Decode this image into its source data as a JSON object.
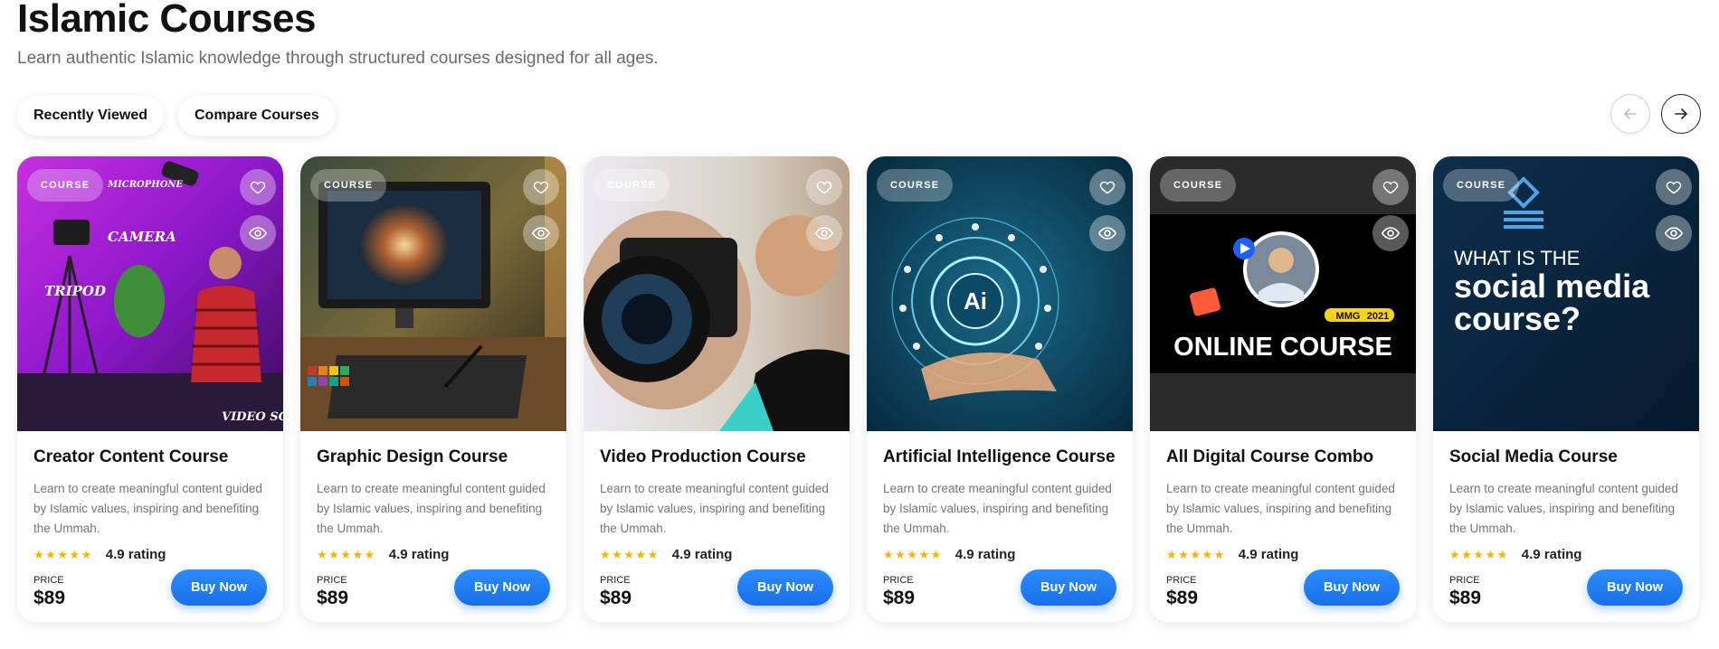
{
  "header": {
    "title": "Islamic Courses",
    "subtitle": "Learn authentic Islamic knowledge through structured courses designed for all ages."
  },
  "filters": {
    "recently_viewed": "Recently Viewed",
    "compare_courses": "Compare Courses"
  },
  "navigation": {
    "prev_icon": "arrow-left-icon",
    "next_icon": "arrow-right-icon"
  },
  "colors": {
    "accent": "#1a7bff",
    "star": "#f5b400"
  },
  "cards": [
    {
      "badge": "COURSE",
      "title": "Creator Content Course",
      "description": "Learn to create meaningful content guided by Islamic values, inspiring and benefiting the Ummah.",
      "stars": "★★★★★",
      "rating": "4.9 rating",
      "price_label": "PRICE",
      "price": "$89",
      "cta": "Buy Now",
      "image": {
        "words": [
          "MICROPHONE",
          "CAMERA",
          "TRIPOD",
          "VIDEO SCRIPT"
        ]
      }
    },
    {
      "badge": "COURSE",
      "title": "Graphic Design Course",
      "description": "Learn to create meaningful content guided by Islamic values, inspiring and benefiting the Ummah.",
      "stars": "★★★★★",
      "rating": "4.9 rating",
      "price_label": "PRICE",
      "price": "$89",
      "cta": "Buy Now"
    },
    {
      "badge": "COURSE",
      "title": "Video Production Course",
      "description": "Learn to create meaningful content guided by Islamic values, inspiring and benefiting the Ummah.",
      "stars": "★★★★★",
      "rating": "4.9 rating",
      "price_label": "PRICE",
      "price": "$89",
      "cta": "Buy Now"
    },
    {
      "badge": "COURSE",
      "title": "Artificial Intelligence Course",
      "description": "Learn to create meaningful content guided by Islamic values, inspiring and benefiting the Ummah.",
      "stars": "★★★★★",
      "rating": "4.9 rating",
      "price_label": "PRICE",
      "price": "$89",
      "cta": "Buy Now",
      "image": {
        "center_text": "Ai"
      }
    },
    {
      "badge": "COURSE",
      "title": "All Digital Course Combo",
      "description": "Learn to create meaningful content guided by Islamic values, inspiring and benefiting the Ummah.",
      "stars": "★★★★★",
      "rating": "4.9 rating",
      "price_label": "PRICE",
      "price": "$89",
      "cta": "Buy Now",
      "image": {
        "brand": "MMG",
        "year": "2021",
        "headline": "ONLINE COURSE"
      }
    },
    {
      "badge": "COURSE",
      "title": "Social Media Course",
      "description": "Learn to create meaningful content guided by Islamic values, inspiring and benefiting the Ummah.",
      "stars": "★★★★★",
      "rating": "4.9 rating",
      "price_label": "PRICE",
      "price": "$89",
      "cta": "Buy Now",
      "image": {
        "line1": "WHAT IS THE",
        "line2": "social media",
        "line3": "course?"
      }
    }
  ]
}
